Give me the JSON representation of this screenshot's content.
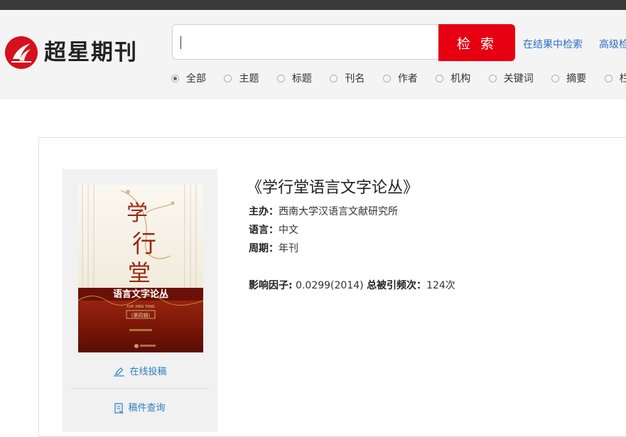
{
  "brand": {
    "name": "超星期刊",
    "accent": "#e60012"
  },
  "search": {
    "query": "",
    "button_label": "检 索"
  },
  "links": {
    "search_in_results": "在结果中检索",
    "advanced": "高级检索"
  },
  "filters": [
    {
      "label": "全部",
      "checked": true
    },
    {
      "label": "主题",
      "checked": false
    },
    {
      "label": "标题",
      "checked": false
    },
    {
      "label": "刊名",
      "checked": false
    },
    {
      "label": "作者",
      "checked": false
    },
    {
      "label": "机构",
      "checked": false
    },
    {
      "label": "关键词",
      "checked": false
    },
    {
      "label": "摘要",
      "checked": false
    },
    {
      "label": "栏目",
      "checked": false
    }
  ],
  "journal": {
    "title": "《学行堂语言文字论丛》",
    "sponsor_label": "主办：",
    "sponsor": "西南大学汉语言文献研究所",
    "language_label": "语言：",
    "language": "中文",
    "frequency_label": "周期：",
    "frequency": "年刊",
    "impact_label": "影响因子:",
    "impact_value": " 0.0299(2014) ",
    "citations_label": "总被引频次：",
    "citations_value": "124次"
  },
  "cover": {
    "calligraphy": [
      "学",
      "行",
      "堂"
    ],
    "title": "语言文字论丛",
    "pinyin": "XUE XING TANG",
    "volume": "(第四辑)"
  },
  "actions": {
    "submit": "在线投稿",
    "query": "稿件查询"
  }
}
